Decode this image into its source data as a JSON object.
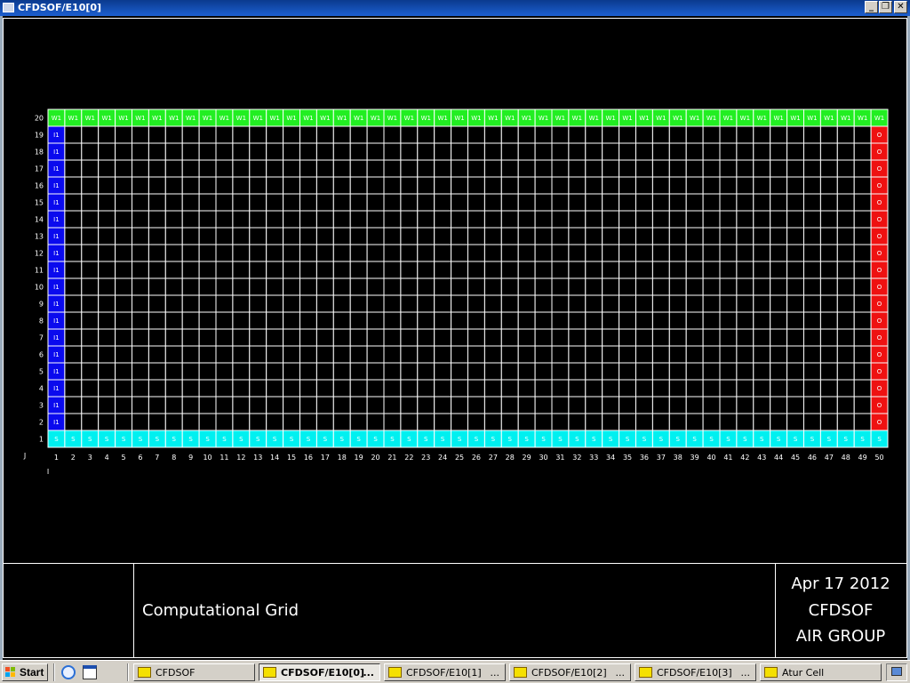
{
  "window": {
    "title": "CFDSOF/E10[0]",
    "controls": {
      "minimize": "_",
      "restore": "❐",
      "close": "✕"
    }
  },
  "grid": {
    "columns": 50,
    "rows": 20,
    "row_axis_label": "J",
    "col_axis_label": "I",
    "top_row_label": "W1",
    "bottom_row_label": "S",
    "left_col_label": "I1",
    "right_col_label": "O",
    "colors": {
      "top": "#22ee22",
      "bottom": "#00f0f0",
      "left": "#0a0aee",
      "right": "#ee1111",
      "interior": "#000000",
      "line": "#ffffff"
    }
  },
  "info": {
    "title": "Computational Grid",
    "date": "Apr 17 2012",
    "program": "CFDSOF",
    "group": "AIR GROUP"
  },
  "taskbar": {
    "start_label": "Start",
    "quick_launch": [
      "ie-icon",
      "show-desktop-icon"
    ],
    "tasks": [
      {
        "label": "CFDSOF",
        "active": false,
        "ellipsis": ""
      },
      {
        "label": "CFDSOF/E10[0]",
        "active": true,
        "ellipsis": "..."
      },
      {
        "label": "CFDSOF/E10[1]",
        "active": false,
        "ellipsis": "..."
      },
      {
        "label": "CFDSOF/E10[2]",
        "active": false,
        "ellipsis": "..."
      },
      {
        "label": "CFDSOF/E10[3]",
        "active": false,
        "ellipsis": "..."
      },
      {
        "label": "Atur Cell",
        "active": false,
        "ellipsis": ""
      }
    ]
  }
}
